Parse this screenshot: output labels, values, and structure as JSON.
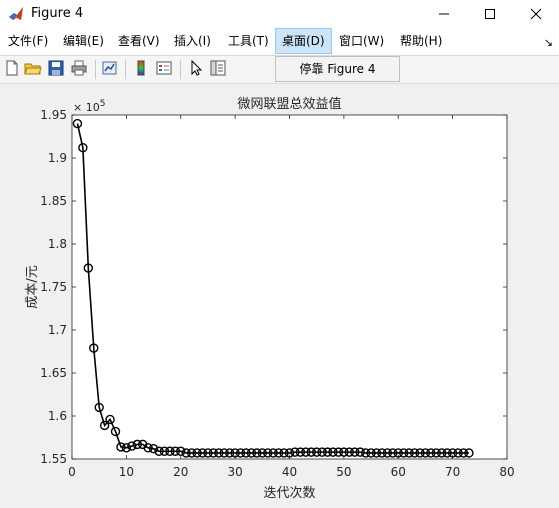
{
  "window": {
    "title": "Figure 4",
    "controls": [
      "minimize",
      "maximize",
      "close"
    ]
  },
  "menu": {
    "items": [
      {
        "label": "文件(F)"
      },
      {
        "label": "编辑(E)"
      },
      {
        "label": "查看(V)"
      },
      {
        "label": "插入(I)"
      },
      {
        "label": "工具(T)"
      },
      {
        "label": "桌面(D)",
        "active": true
      },
      {
        "label": "窗口(W)"
      },
      {
        "label": "帮助(H)"
      }
    ],
    "pin_glyph": "↘"
  },
  "toolbar": {
    "icons": [
      "new-file-icon",
      "open-folder-icon",
      "save-icon",
      "print-icon",
      "link-plot-icon",
      "colorbar-icon",
      "legend-icon",
      "pointer-icon",
      "property-editor-icon"
    ],
    "dock_label": "停靠 Figure 4"
  },
  "chart_data": {
    "type": "line",
    "title": "微网联盟总效益值",
    "xlabel": "迭代次数",
    "ylabel": "成本/元",
    "y_exponent_label": "× 10",
    "y_exponent": "5",
    "xlim": [
      0,
      80
    ],
    "ylim": [
      1.55,
      1.95
    ],
    "xticks": [
      0,
      10,
      20,
      30,
      40,
      50,
      60,
      70,
      80
    ],
    "yticks": [
      1.55,
      1.6,
      1.65,
      1.7,
      1.75,
      1.8,
      1.85,
      1.9,
      1.95
    ],
    "ytick_labels": [
      "1.55",
      "1.6",
      "1.65",
      "1.7",
      "1.75",
      "1.8",
      "1.85",
      "1.9",
      "1.95"
    ],
    "grid": false,
    "marker": "circle",
    "line_color": "#000000",
    "series": [
      {
        "x": [
          1,
          2,
          3,
          4,
          5,
          6,
          7,
          8,
          9,
          10,
          11,
          12,
          13,
          14,
          15,
          16,
          17,
          18,
          19,
          20,
          21,
          22,
          23,
          24,
          25,
          26,
          27,
          28,
          29,
          30,
          31,
          32,
          33,
          34,
          35,
          36,
          37,
          38,
          39,
          40,
          41,
          42,
          43,
          44,
          45,
          46,
          47,
          48,
          49,
          50,
          51,
          52,
          53,
          54,
          55,
          56,
          57,
          58,
          59,
          60,
          61,
          62,
          63,
          64,
          65,
          66,
          67,
          68,
          69,
          70,
          71,
          72,
          73
        ],
        "y": [
          1.94,
          1.912,
          1.772,
          1.679,
          1.61,
          1.589,
          1.596,
          1.582,
          1.564,
          1.563,
          1.565,
          1.567,
          1.567,
          1.563,
          1.562,
          1.559,
          1.559,
          1.559,
          1.559,
          1.559,
          1.557,
          1.557,
          1.557,
          1.557,
          1.557,
          1.557,
          1.557,
          1.557,
          1.557,
          1.557,
          1.557,
          1.557,
          1.557,
          1.557,
          1.557,
          1.557,
          1.557,
          1.557,
          1.557,
          1.557,
          1.558,
          1.558,
          1.558,
          1.558,
          1.558,
          1.558,
          1.558,
          1.558,
          1.558,
          1.558,
          1.558,
          1.558,
          1.558,
          1.557,
          1.557,
          1.557,
          1.557,
          1.557,
          1.557,
          1.557,
          1.557,
          1.557,
          1.557,
          1.557,
          1.557,
          1.557,
          1.557,
          1.557,
          1.557,
          1.557,
          1.557,
          1.557,
          1.557
        ]
      }
    ]
  }
}
